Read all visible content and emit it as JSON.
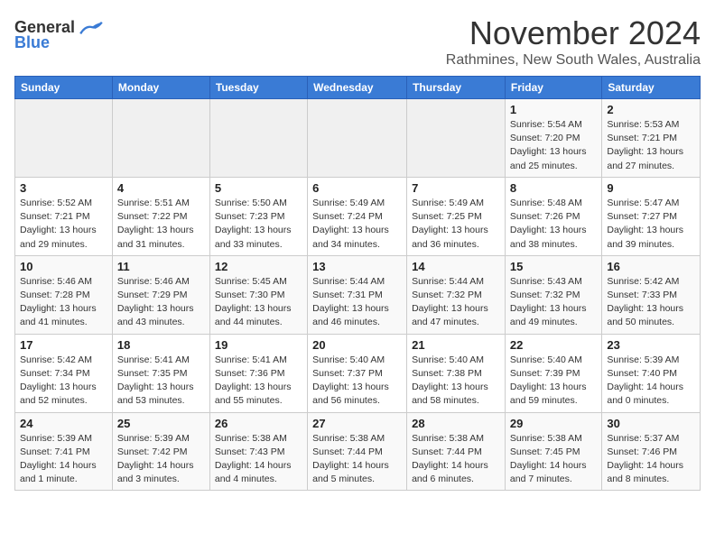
{
  "header": {
    "logo_general": "General",
    "logo_blue": "Blue",
    "month_title": "November 2024",
    "location": "Rathmines, New South Wales, Australia"
  },
  "days_of_week": [
    "Sunday",
    "Monday",
    "Tuesday",
    "Wednesday",
    "Thursday",
    "Friday",
    "Saturday"
  ],
  "weeks": [
    [
      {
        "day": "",
        "detail": ""
      },
      {
        "day": "",
        "detail": ""
      },
      {
        "day": "",
        "detail": ""
      },
      {
        "day": "",
        "detail": ""
      },
      {
        "day": "",
        "detail": ""
      },
      {
        "day": "1",
        "detail": "Sunrise: 5:54 AM\nSunset: 7:20 PM\nDaylight: 13 hours and 25 minutes."
      },
      {
        "day": "2",
        "detail": "Sunrise: 5:53 AM\nSunset: 7:21 PM\nDaylight: 13 hours and 27 minutes."
      }
    ],
    [
      {
        "day": "3",
        "detail": "Sunrise: 5:52 AM\nSunset: 7:21 PM\nDaylight: 13 hours and 29 minutes."
      },
      {
        "day": "4",
        "detail": "Sunrise: 5:51 AM\nSunset: 7:22 PM\nDaylight: 13 hours and 31 minutes."
      },
      {
        "day": "5",
        "detail": "Sunrise: 5:50 AM\nSunset: 7:23 PM\nDaylight: 13 hours and 33 minutes."
      },
      {
        "day": "6",
        "detail": "Sunrise: 5:49 AM\nSunset: 7:24 PM\nDaylight: 13 hours and 34 minutes."
      },
      {
        "day": "7",
        "detail": "Sunrise: 5:49 AM\nSunset: 7:25 PM\nDaylight: 13 hours and 36 minutes."
      },
      {
        "day": "8",
        "detail": "Sunrise: 5:48 AM\nSunset: 7:26 PM\nDaylight: 13 hours and 38 minutes."
      },
      {
        "day": "9",
        "detail": "Sunrise: 5:47 AM\nSunset: 7:27 PM\nDaylight: 13 hours and 39 minutes."
      }
    ],
    [
      {
        "day": "10",
        "detail": "Sunrise: 5:46 AM\nSunset: 7:28 PM\nDaylight: 13 hours and 41 minutes."
      },
      {
        "day": "11",
        "detail": "Sunrise: 5:46 AM\nSunset: 7:29 PM\nDaylight: 13 hours and 43 minutes."
      },
      {
        "day": "12",
        "detail": "Sunrise: 5:45 AM\nSunset: 7:30 PM\nDaylight: 13 hours and 44 minutes."
      },
      {
        "day": "13",
        "detail": "Sunrise: 5:44 AM\nSunset: 7:31 PM\nDaylight: 13 hours and 46 minutes."
      },
      {
        "day": "14",
        "detail": "Sunrise: 5:44 AM\nSunset: 7:32 PM\nDaylight: 13 hours and 47 minutes."
      },
      {
        "day": "15",
        "detail": "Sunrise: 5:43 AM\nSunset: 7:32 PM\nDaylight: 13 hours and 49 minutes."
      },
      {
        "day": "16",
        "detail": "Sunrise: 5:42 AM\nSunset: 7:33 PM\nDaylight: 13 hours and 50 minutes."
      }
    ],
    [
      {
        "day": "17",
        "detail": "Sunrise: 5:42 AM\nSunset: 7:34 PM\nDaylight: 13 hours and 52 minutes."
      },
      {
        "day": "18",
        "detail": "Sunrise: 5:41 AM\nSunset: 7:35 PM\nDaylight: 13 hours and 53 minutes."
      },
      {
        "day": "19",
        "detail": "Sunrise: 5:41 AM\nSunset: 7:36 PM\nDaylight: 13 hours and 55 minutes."
      },
      {
        "day": "20",
        "detail": "Sunrise: 5:40 AM\nSunset: 7:37 PM\nDaylight: 13 hours and 56 minutes."
      },
      {
        "day": "21",
        "detail": "Sunrise: 5:40 AM\nSunset: 7:38 PM\nDaylight: 13 hours and 58 minutes."
      },
      {
        "day": "22",
        "detail": "Sunrise: 5:40 AM\nSunset: 7:39 PM\nDaylight: 13 hours and 59 minutes."
      },
      {
        "day": "23",
        "detail": "Sunrise: 5:39 AM\nSunset: 7:40 PM\nDaylight: 14 hours and 0 minutes."
      }
    ],
    [
      {
        "day": "24",
        "detail": "Sunrise: 5:39 AM\nSunset: 7:41 PM\nDaylight: 14 hours and 1 minute."
      },
      {
        "day": "25",
        "detail": "Sunrise: 5:39 AM\nSunset: 7:42 PM\nDaylight: 14 hours and 3 minutes."
      },
      {
        "day": "26",
        "detail": "Sunrise: 5:38 AM\nSunset: 7:43 PM\nDaylight: 14 hours and 4 minutes."
      },
      {
        "day": "27",
        "detail": "Sunrise: 5:38 AM\nSunset: 7:44 PM\nDaylight: 14 hours and 5 minutes."
      },
      {
        "day": "28",
        "detail": "Sunrise: 5:38 AM\nSunset: 7:44 PM\nDaylight: 14 hours and 6 minutes."
      },
      {
        "day": "29",
        "detail": "Sunrise: 5:38 AM\nSunset: 7:45 PM\nDaylight: 14 hours and 7 minutes."
      },
      {
        "day": "30",
        "detail": "Sunrise: 5:37 AM\nSunset: 7:46 PM\nDaylight: 14 hours and 8 minutes."
      }
    ]
  ]
}
